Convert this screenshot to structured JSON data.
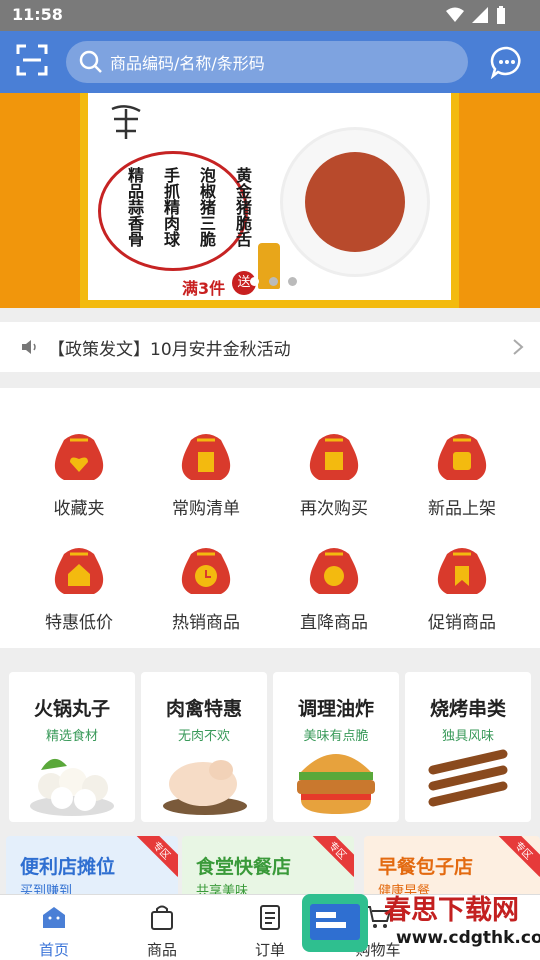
{
  "status_bar": {
    "time": "11:58"
  },
  "search": {
    "placeholder": "商品编码/名称/条形码"
  },
  "banner": {
    "menu_columns": [
      "精品蒜香骨",
      "手抓精肉球",
      "泡椒猪三脆",
      "黄金猪脆舌"
    ],
    "promo_text": "满3件",
    "gift_text": "送"
  },
  "notice": {
    "text": "【政策发文】10月安井金秋活动"
  },
  "quick_menu": [
    {
      "label": "收藏夹",
      "icon": "heart-bag-icon"
    },
    {
      "label": "常购清单",
      "icon": "list-bag-icon"
    },
    {
      "label": "再次购买",
      "icon": "cart-bag-icon"
    },
    {
      "label": "新品上架",
      "icon": "upload-bag-icon"
    },
    {
      "label": "特惠低价",
      "icon": "store-bag-icon"
    },
    {
      "label": "热销商品",
      "icon": "clock-bag-icon"
    },
    {
      "label": "直降商品",
      "icon": "badge-bag-icon"
    },
    {
      "label": "促销商品",
      "icon": "bookmark-bag-icon"
    }
  ],
  "categories": [
    {
      "title": "火锅丸子",
      "subtitle": "精选食材"
    },
    {
      "title": "肉禽特惠",
      "subtitle": "无肉不欢"
    },
    {
      "title": "调理油炸",
      "subtitle": "美味有点脆"
    },
    {
      "title": "烧烤串类",
      "subtitle": "独具风味"
    }
  ],
  "zones": [
    {
      "title": "便利店摊位",
      "subtitle": "买到赚到",
      "tag": "专区",
      "color": "#2f6fd1"
    },
    {
      "title": "食堂快餐店",
      "subtitle": "共享美味",
      "tag": "专区",
      "color": "#3a9a3a"
    },
    {
      "title": "早餐包子店",
      "subtitle": "健康早餐",
      "tag": "专区",
      "color": "#e36a10"
    }
  ],
  "tabs": [
    {
      "label": "首页",
      "active": true
    },
    {
      "label": "商品"
    },
    {
      "label": "订单"
    },
    {
      "label": "购物车"
    }
  ],
  "watermark": {
    "brand": "春思下载网",
    "url": "www.cdgthk.com"
  },
  "colors": {
    "primary": "#4a7fd6",
    "bag_red": "#d93a2c",
    "accent_gold": "#f3ba0f"
  }
}
